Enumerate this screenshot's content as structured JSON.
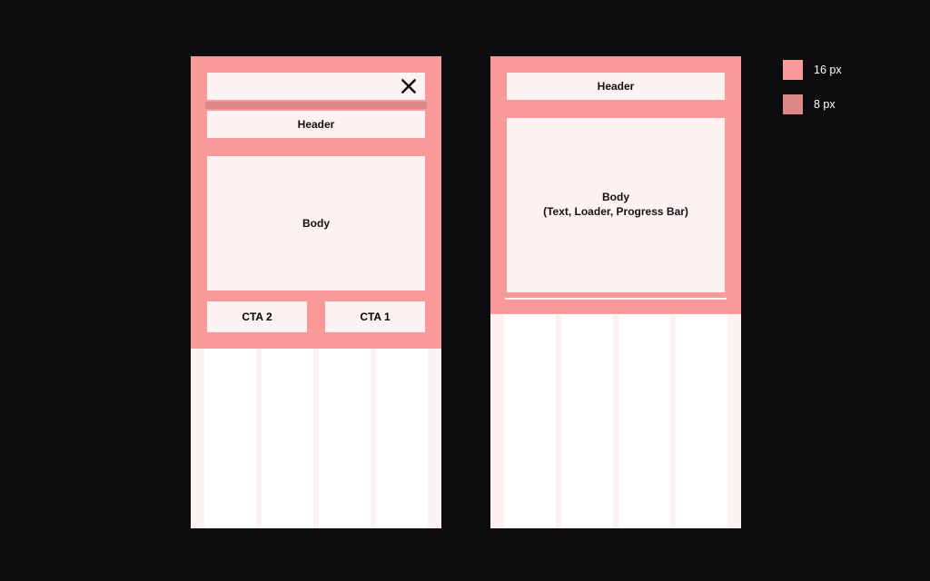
{
  "legend": {
    "px16": "16 px",
    "px8": "8 px"
  },
  "left": {
    "header": "Header",
    "body": "Body",
    "cta2": "CTA 2",
    "cta1": "CTA 1"
  },
  "right": {
    "header": "Header",
    "body_line1": "Body",
    "body_line2": "(Text, Loader, Progress Bar)"
  }
}
